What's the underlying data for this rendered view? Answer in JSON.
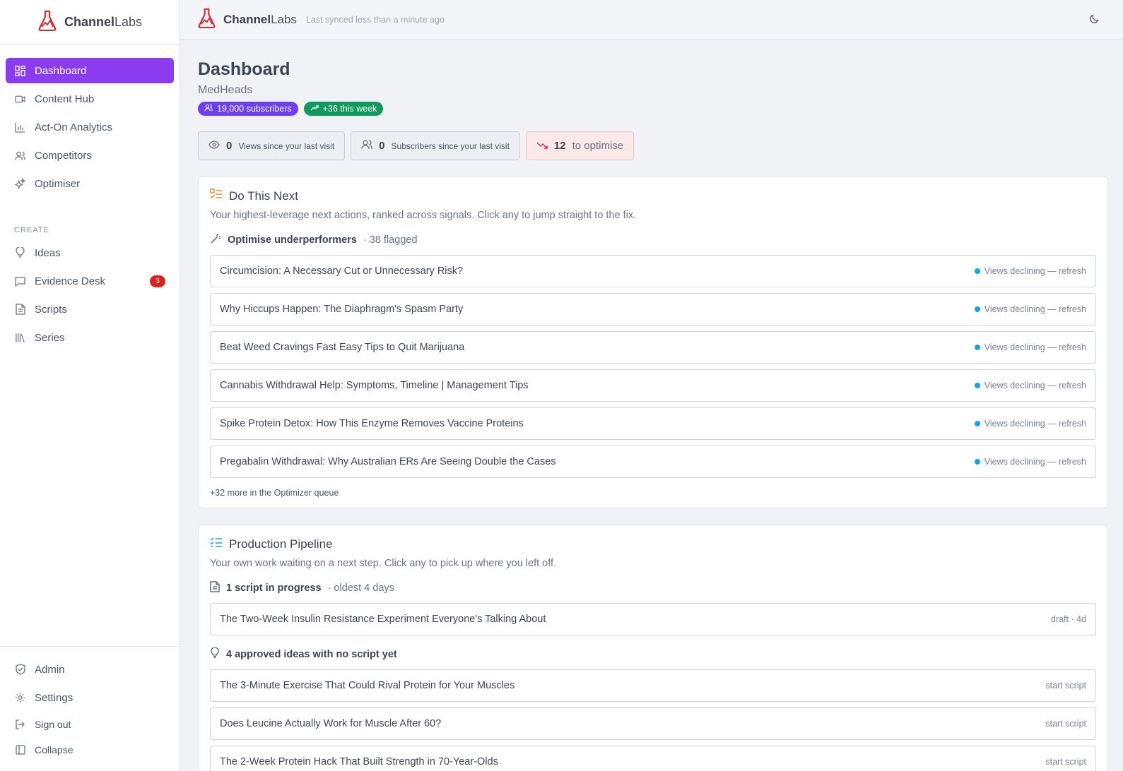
{
  "brand": {
    "name_bold": "Channel",
    "name_light": "Labs"
  },
  "topbar": {
    "synced": "Last synced less than a minute ago"
  },
  "sidebar": {
    "items": [
      {
        "label": "Dashboard",
        "icon": "dashboard-icon",
        "active": true
      },
      {
        "label": "Content Hub",
        "icon": "video-icon"
      },
      {
        "label": "Act-On Analytics",
        "icon": "bar-chart-icon"
      },
      {
        "label": "Competitors",
        "icon": "users-icon"
      },
      {
        "label": "Optimiser",
        "icon": "sparkles-icon"
      }
    ],
    "section_label": "CREATE",
    "create_items": [
      {
        "label": "Ideas",
        "icon": "lightbulb-icon"
      },
      {
        "label": "Evidence Desk",
        "icon": "message-icon",
        "badge": "3"
      },
      {
        "label": "Scripts",
        "icon": "file-text-icon"
      },
      {
        "label": "Series",
        "icon": "library-icon"
      }
    ],
    "bottom": {
      "admin": "Admin",
      "settings": "Settings",
      "sign_out": "Sign out",
      "collapse": "Collapse"
    }
  },
  "page": {
    "title": "Dashboard",
    "channel": "MedHeads",
    "subscribers_pill": "19,000 subscribers",
    "growth_pill": "+36 this week",
    "stats": {
      "views_num": "0",
      "views_label": "Views since your last visit",
      "subs_num": "0",
      "subs_label": "Subscribers since your last visit",
      "optimise_num": "12",
      "optimise_label": "to optimise"
    }
  },
  "do_next": {
    "title": "Do This Next",
    "desc": "Your highest-leverage next actions, ranked across signals. Click any to jump straight to the fix.",
    "group_title": "Optimise underperformers",
    "group_meta": "· 38 flagged",
    "rows": [
      {
        "title": "Circumcision: A Necessary Cut or Unnecessary Risk?",
        "status": "Views declining — refresh"
      },
      {
        "title": "Why Hiccups Happen: The Diaphragm's Spasm Party",
        "status": "Views declining — refresh"
      },
      {
        "title": "Beat Weed Cravings Fast Easy Tips to Quit Marijuana",
        "status": "Views declining — refresh"
      },
      {
        "title": "Cannabis Withdrawal Help: Symptoms, Timeline | Management Tips",
        "status": "Views declining — refresh"
      },
      {
        "title": "Spike Protein Detox: How This Enzyme Removes Vaccine Proteins",
        "status": "Views declining — refresh"
      },
      {
        "title": "Pregabalin Withdrawal: Why Australian ERs Are Seeing Double the Cases",
        "status": "Views declining — refresh"
      }
    ],
    "more": "+32 more in the Optimizer queue"
  },
  "pipeline": {
    "title": "Production Pipeline",
    "desc": "Your own work waiting on a next step. Click any to pick up where you left off.",
    "scripts_title": "1 script in progress",
    "scripts_meta": "· oldest 4 days",
    "script_rows": [
      {
        "title": "The Two-Week Insulin Resistance Experiment Everyone's Talking About",
        "status": "draft · 4d"
      }
    ],
    "ideas_title": "4 approved ideas with no script yet",
    "idea_rows": [
      {
        "title": "The 3-Minute Exercise That Could Rival Protein for Your Muscles",
        "status": "start script"
      },
      {
        "title": "Does Leucine Actually Work for Muscle After 60?",
        "status": "start script"
      },
      {
        "title": "The 2-Week Protein Hack That Built Strength in 70-Year-Olds",
        "status": "start script"
      }
    ]
  },
  "colors": {
    "accent": "#8b3cf0",
    "violet_pill": "#6d3ff0",
    "green_pill": "#0d9a5c",
    "badge": "#e01e1e",
    "status_dot": "#0ea5e9",
    "logo": "#d32f2f"
  }
}
